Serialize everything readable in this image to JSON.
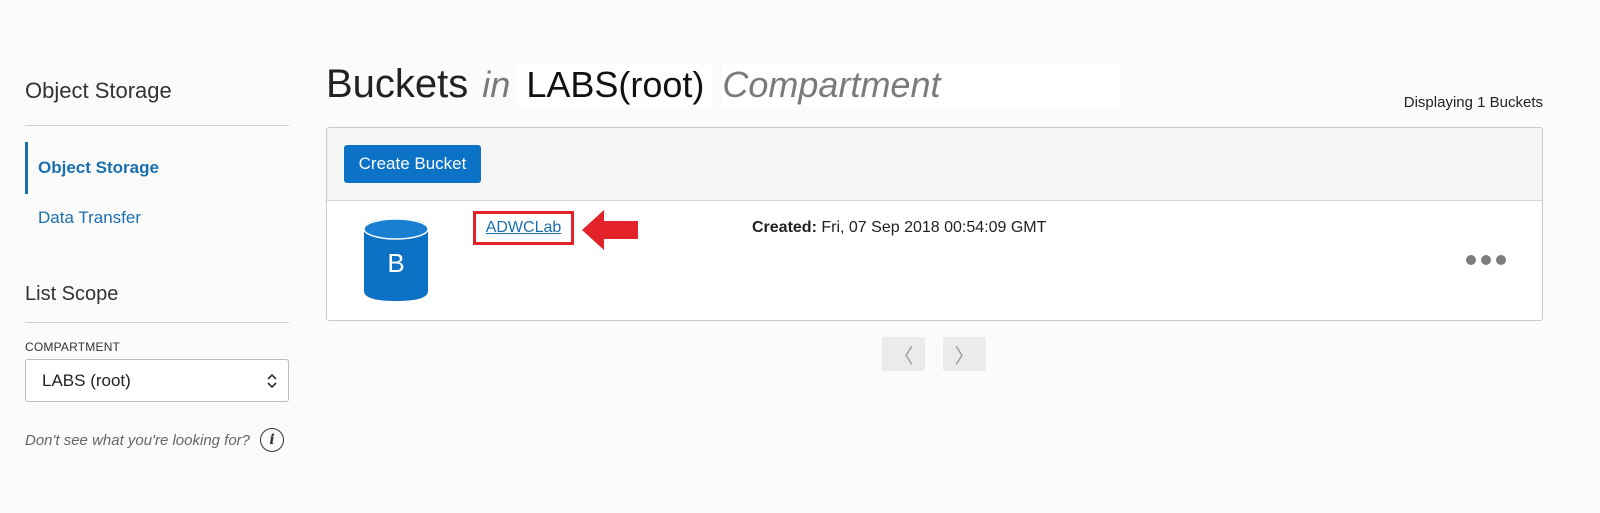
{
  "sidebar": {
    "title": "Object Storage",
    "nav": [
      {
        "label": "Object Storage",
        "active": true
      },
      {
        "label": "Data Transfer",
        "active": false
      }
    ],
    "list_scope_title": "List Scope",
    "compartment_label": "COMPARTMENT",
    "compartment_value": "LABS (root)",
    "help_text": "Don't see what you're looking for?",
    "help_icon": "info-icon"
  },
  "header": {
    "title_main": "Buckets",
    "title_in": "in",
    "title_compartment": "LABS(root)",
    "title_suffix": "Compartment",
    "displaying": "Displaying 1 Buckets"
  },
  "toolbar": {
    "create_label": "Create Bucket"
  },
  "buckets": [
    {
      "icon_letter": "B",
      "name": "ADWCLab",
      "created_label": "Created:",
      "created_value": "Fri, 07 Sep 2018 00:54:09 GMT",
      "actions_icon": "more-horizontal-icon"
    }
  ],
  "pagination": {
    "prev_glyph": "〈",
    "next_glyph": "〉"
  },
  "colors": {
    "accent": "#0b72c6",
    "link": "#1a6fae",
    "highlight": "#e3222a"
  }
}
